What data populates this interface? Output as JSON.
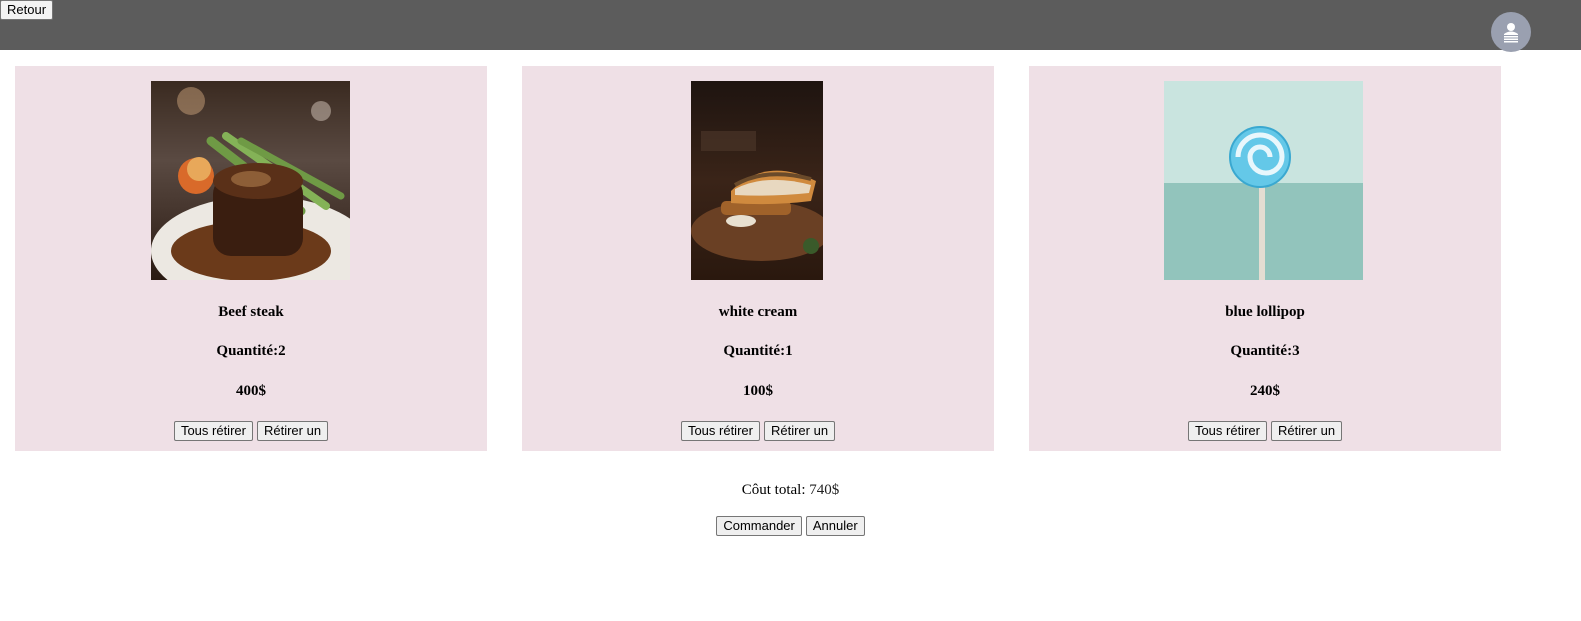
{
  "header": {
    "back_label": "Retour",
    "avatar_icon": "user-icon"
  },
  "items": [
    {
      "name": "Beef steak",
      "quantity": "Quantité:2",
      "price": "400$",
      "remove_all_label": "Tous rétirer",
      "remove_one_label": "Rétirer un",
      "image": "beef-steak-photo"
    },
    {
      "name": "white cream",
      "quantity": "Quantité:1",
      "price": "100$",
      "remove_all_label": "Tous rétirer",
      "remove_one_label": "Rétirer un",
      "image": "sandwich-photo"
    },
    {
      "name": "blue lollipop",
      "quantity": "Quantité:3",
      "price": "240$",
      "remove_all_label": "Tous rétirer",
      "remove_one_label": "Rétirer un",
      "image": "lollipop-photo"
    }
  ],
  "summary": {
    "total_label": "Côut total:",
    "total_value": "740$",
    "order_label": "Commander",
    "cancel_label": "Annuler"
  },
  "colors": {
    "topbar": "#5c5c5c",
    "card_background": "#efe0e6"
  }
}
